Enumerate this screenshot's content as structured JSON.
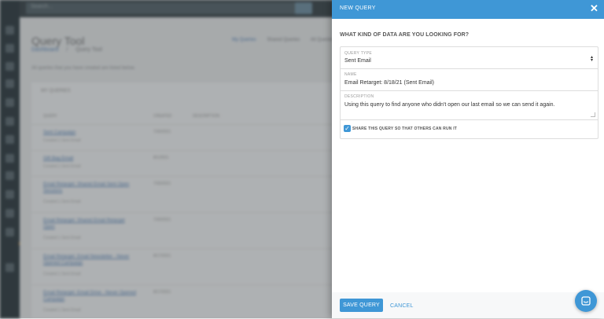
{
  "background": {
    "search_placeholder": "Search...",
    "page_title": "Query Tool",
    "breadcrumb_root": "Dashboard",
    "breadcrumb_sep": "/",
    "breadcrumb_current": "Query Tool",
    "top_links": [
      "My Queries",
      "Shared Queries",
      "All Queries"
    ],
    "intro_text": "All queries that you have created are listed below.",
    "card_header": "MY QUERIES",
    "columns": [
      "QUERY",
      "CREATED",
      "DESCRIPTION"
    ],
    "rows": [
      {
        "name": "Sent Campaign",
        "sub": "Created 1 Sent Email",
        "date": "7/30/2021"
      },
      {
        "name": "Gift Bag Email",
        "sub": "Created 1 Sent Email",
        "date": "8/1/2021"
      },
      {
        "name": "Email Retarget: Shared Email Sent Open Sessions",
        "sub": "Created 1 Sent Email",
        "date": "7/30/2021"
      },
      {
        "name": "Email Retarget: Shared Email Retarget Open",
        "sub": "Created 1 Sent Email",
        "date": "7/30/2021"
      },
      {
        "name": "Email Retarget: Email Newsletter - Never Opened Campaign",
        "sub": "Created 1 Sent Email",
        "date": "8/17/2021"
      },
      {
        "name": "Email Retarget: Email Drive - Never Opened Campaign",
        "sub": "Created 1 Sent Email",
        "date": "8/17/2021"
      }
    ]
  },
  "panel": {
    "title": "NEW QUERY",
    "question": "WHAT KIND OF DATA ARE YOU LOOKING FOR?",
    "query_type_label": "QUERY TYPE",
    "query_type_value": "Sent Email",
    "name_label": "NAME",
    "name_value": "Email Retarget: 8/18/21 (Sent Email)",
    "description_label": "DESCRIPTION",
    "description_value": "Using this query to find anyone who didn't open our last email so we can send it again.",
    "share_label": "SHARE THIS QUERY SO THAT OTHERS CAN RUN IT",
    "share_checked": true,
    "save_label": "SAVE QUERY",
    "cancel_label": "CANCEL"
  },
  "colors": {
    "accent": "#3f97d6",
    "nav_dark": "#2f3a40"
  },
  "icons": {
    "close": "close-icon",
    "chat": "chat-icon",
    "select": "select-caret-icon",
    "check": "checkmark-icon"
  }
}
